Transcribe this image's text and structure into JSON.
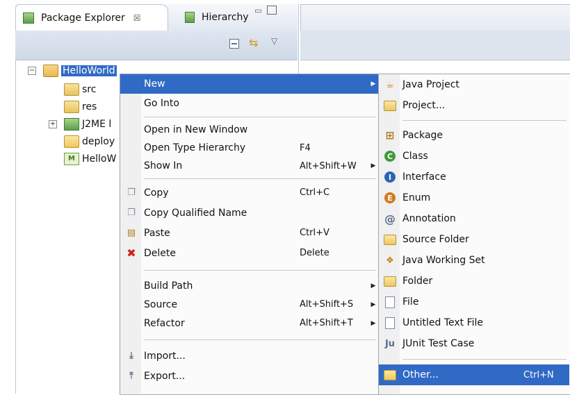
{
  "tabs": {
    "package_explorer": "Package Explorer",
    "hierarchy": "Hierarchy",
    "close_glyph": "☒"
  },
  "icons": {
    "collapse_all": "collapse-all-icon",
    "link_with_editor": "link-with-editor-icon",
    "view_menu": "view-menu-icon"
  },
  "tree": {
    "root": "HelloWorld",
    "items": [
      "src",
      "res",
      "J2ME l",
      "deploy",
      "HelloW"
    ]
  },
  "context_menu": {
    "new": "New",
    "go_into": "Go Into",
    "open_new_window": "Open in New Window",
    "open_type_hierarchy": "Open Type Hierarchy",
    "open_type_hierarchy_sc": "F4",
    "show_in": "Show In",
    "show_in_sc": "Alt+Shift+W",
    "copy": "Copy",
    "copy_sc": "Ctrl+C",
    "copy_qualified": "Copy Qualified Name",
    "paste": "Paste",
    "paste_sc": "Ctrl+V",
    "delete": "Delete",
    "delete_sc": "Delete",
    "build_path": "Build Path",
    "source": "Source",
    "source_sc": "Alt+Shift+S",
    "refactor": "Refactor",
    "refactor_sc": "Alt+Shift+T",
    "import": "Import...",
    "export": "Export..."
  },
  "submenu": {
    "java_project": "Java Project",
    "project": "Project...",
    "package": "Package",
    "class": "Class",
    "interface": "Interface",
    "enum": "Enum",
    "annotation": "Annotation",
    "source_folder": "Source Folder",
    "java_working_set": "Java Working Set",
    "folder": "Folder",
    "file": "File",
    "untitled_text_file": "Untitled Text File",
    "junit_test_case": "JUnit Test Case",
    "other": "Other...",
    "other_sc": "Ctrl+N"
  },
  "colors": {
    "selection": "#316ac5",
    "menu_bg": "#fbfbfb",
    "view_border": "#b7c3d3"
  }
}
